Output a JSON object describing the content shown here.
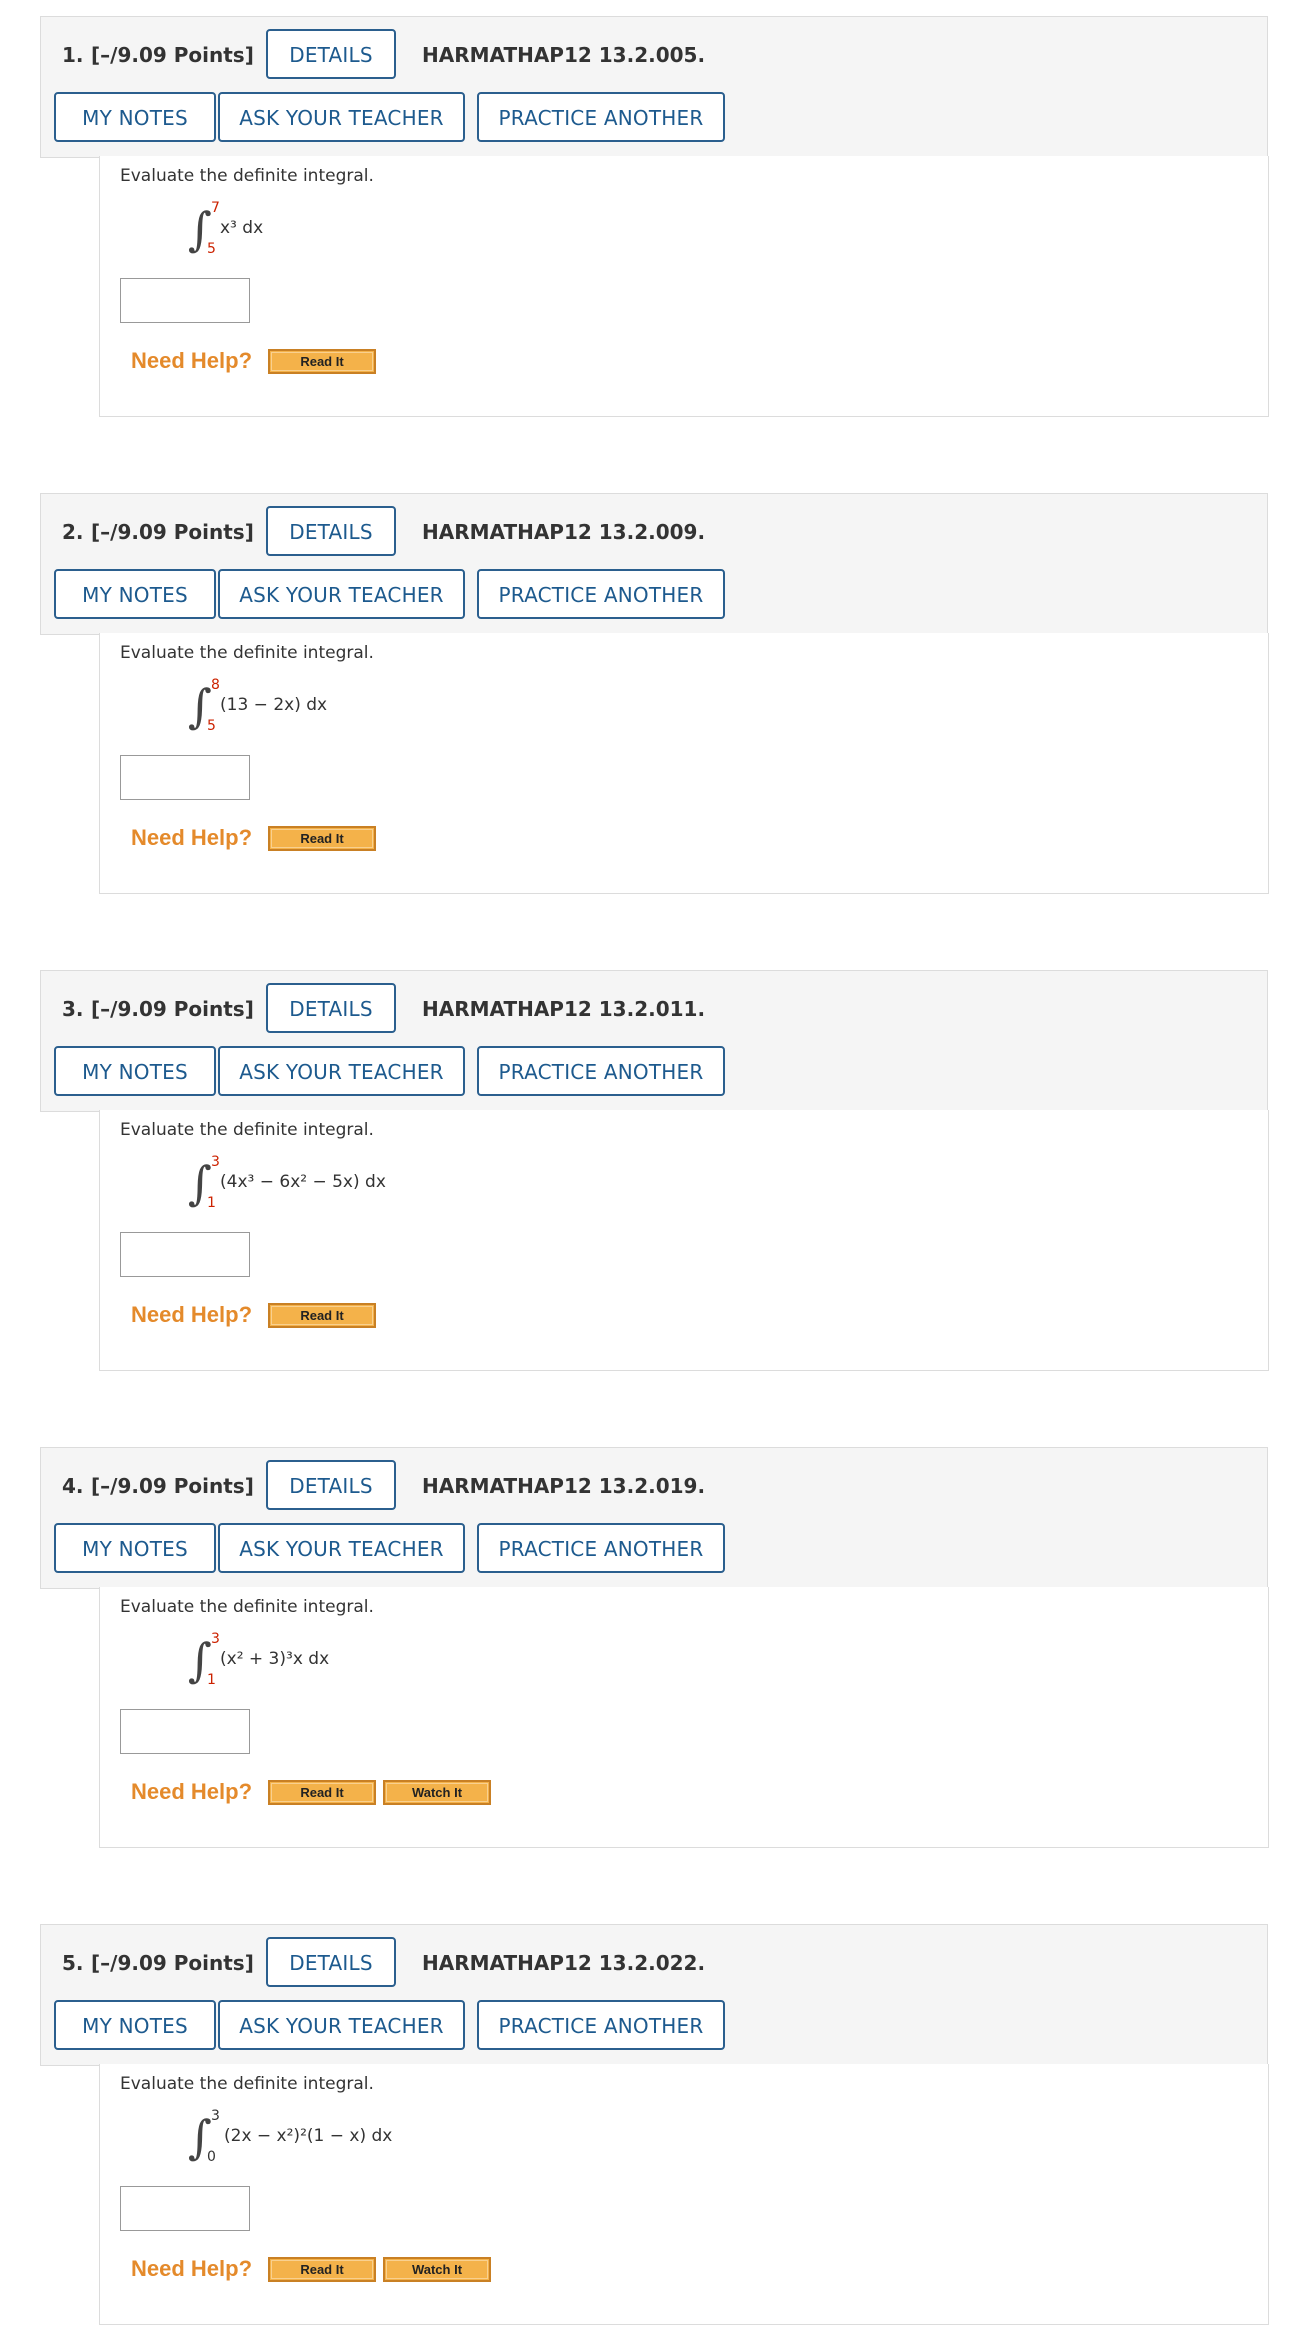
{
  "questions": [
    {
      "number": "1.",
      "points": "[–/9.09 Points]",
      "details": "DETAILS",
      "code": "HARMATHAP12 13.2.005.",
      "my_notes": "MY NOTES",
      "ask_teacher": "ASK YOUR TEACHER",
      "practice_another": "PRACTICE ANOTHER",
      "prompt": "Evaluate the definite integral.",
      "integral_sign": "∫",
      "upper_limit": "7",
      "lower_limit": "5",
      "integrand": "x³ dx",
      "need_help": "Need Help?",
      "read_it": "Read It"
    },
    {
      "number": "2.",
      "points": "[–/9.09 Points]",
      "details": "DETAILS",
      "code": "HARMATHAP12 13.2.009.",
      "my_notes": "MY NOTES",
      "ask_teacher": "ASK YOUR TEACHER",
      "practice_another": "PRACTICE ANOTHER",
      "prompt": "Evaluate the definite integral.",
      "integral_sign": "∫",
      "upper_limit": "8",
      "lower_limit": "5",
      "integrand": "(13 − 2x) dx",
      "need_help": "Need Help?",
      "read_it": "Read It"
    },
    {
      "number": "3.",
      "points": "[–/9.09 Points]",
      "details": "DETAILS",
      "code": "HARMATHAP12 13.2.011.",
      "my_notes": "MY NOTES",
      "ask_teacher": "ASK YOUR TEACHER",
      "practice_another": "PRACTICE ANOTHER",
      "prompt": "Evaluate the definite integral.",
      "integral_sign": "∫",
      "upper_limit": "3",
      "lower_limit": "1",
      "integrand": "(4x³ − 6x² − 5x) dx",
      "need_help": "Need Help?",
      "read_it": "Read It"
    },
    {
      "number": "4.",
      "points": "[–/9.09 Points]",
      "details": "DETAILS",
      "code": "HARMATHAP12 13.2.019.",
      "my_notes": "MY NOTES",
      "ask_teacher": "ASK YOUR TEACHER",
      "practice_another": "PRACTICE ANOTHER",
      "prompt": "Evaluate the definite integral.",
      "integral_sign": "∫",
      "upper_limit": "3",
      "lower_limit": "1",
      "integrand": "(x² + 3)³x dx",
      "need_help": "Need Help?",
      "read_it": "Read It",
      "watch_it": "Watch It"
    },
    {
      "number": "5.",
      "points": "[–/9.09 Points]",
      "details": "DETAILS",
      "code": "HARMATHAP12 13.2.022.",
      "my_notes": "MY NOTES",
      "ask_teacher": "ASK YOUR TEACHER",
      "practice_another": "PRACTICE ANOTHER",
      "prompt": "Evaluate the definite integral.",
      "integral_sign": "∫",
      "upper_limit": "3",
      "lower_limit": "0",
      "integrand": "(2x − x²)²(1 − x) dx",
      "need_help": "Need Help?",
      "read_it": "Read It",
      "watch_it": "Watch It"
    }
  ],
  "colors": {
    "link_blue": "#1d5a8e",
    "help_orange": "#e48a2b",
    "limit_red": "#cc2200",
    "header_bg": "#f5f5f5"
  }
}
